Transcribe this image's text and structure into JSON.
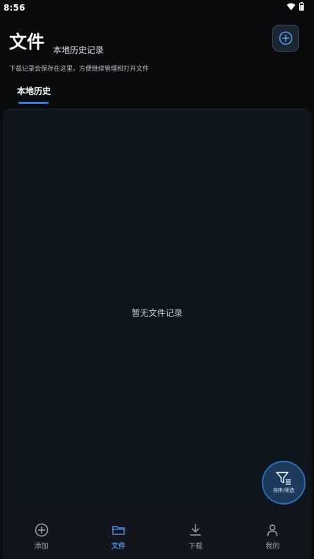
{
  "status_bar": {
    "time": "8:56"
  },
  "header": {
    "title": "文件",
    "subtitle": "本地历史记录",
    "description": "下载记录会保存在这里，方便继续管理和打开文件",
    "add_icon": "plus-circle-icon"
  },
  "tabs": [
    {
      "label": "本地历史",
      "active": true
    }
  ],
  "empty_state": {
    "message": "暂无文件记录"
  },
  "fab": {
    "label": "排序/筛选",
    "icon": "filter-icon"
  },
  "bottom_nav": [
    {
      "label": "添加",
      "icon": "plus-circle-icon",
      "active": false
    },
    {
      "label": "文件",
      "icon": "folder-icon",
      "active": true
    },
    {
      "label": "下载",
      "icon": "download-icon",
      "active": false
    },
    {
      "label": "我的",
      "icon": "user-icon",
      "active": false
    }
  ],
  "colors": {
    "accent": "#4a90e2",
    "background": "#0a0b0d",
    "panel": "#0f151c"
  }
}
